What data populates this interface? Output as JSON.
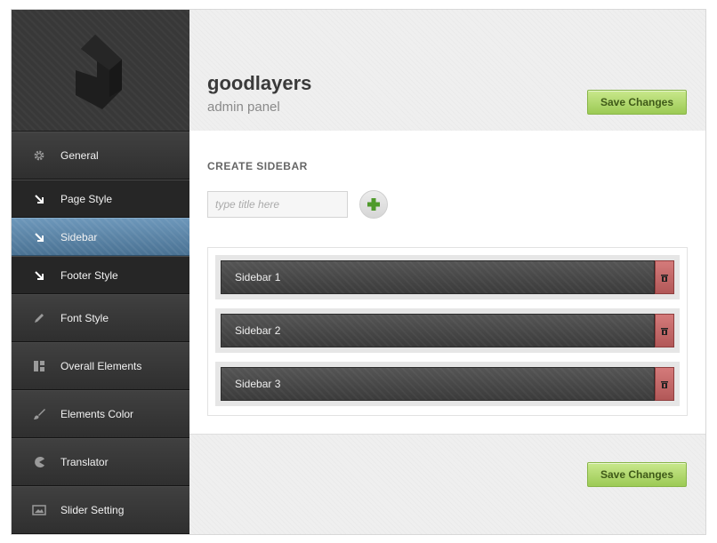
{
  "header": {
    "title": "goodlayers",
    "subtitle": "admin panel",
    "save_label": "Save Changes"
  },
  "logo": {
    "icon": "goodlayers-logo-icon"
  },
  "nav": {
    "items": [
      {
        "label": "General",
        "icon": "gear-icon",
        "type": "main"
      },
      {
        "label": "Page Style",
        "icon": "arrow-down-right-icon",
        "type": "sub"
      },
      {
        "label": "Sidebar",
        "icon": "arrow-down-right-icon",
        "type": "sub",
        "active": true
      },
      {
        "label": "Footer Style",
        "icon": "arrow-down-right-icon",
        "type": "sub"
      },
      {
        "label": "Font Style",
        "icon": "pencil-icon",
        "type": "main"
      },
      {
        "label": "Overall Elements",
        "icon": "layout-icon",
        "type": "main"
      },
      {
        "label": "Elements Color",
        "icon": "brush-icon",
        "type": "main"
      },
      {
        "label": "Translator",
        "icon": "pacman-icon",
        "type": "main"
      },
      {
        "label": "Slider Setting",
        "icon": "slider-icon",
        "type": "main"
      }
    ]
  },
  "content": {
    "section_title": "CREATE SIDEBAR",
    "input_placeholder": "type title here",
    "input_value": "",
    "add_icon": "plus-icon",
    "sidebars": [
      {
        "label": "Sidebar 1"
      },
      {
        "label": "Sidebar 2"
      },
      {
        "label": "Sidebar 3"
      }
    ]
  },
  "footer": {
    "save_label": "Save Changes"
  },
  "colors": {
    "accent_green": "#9cca55",
    "active_blue": "#5b84a6",
    "delete_red": "#c06464",
    "dark_bg": "#2e2e2e"
  }
}
